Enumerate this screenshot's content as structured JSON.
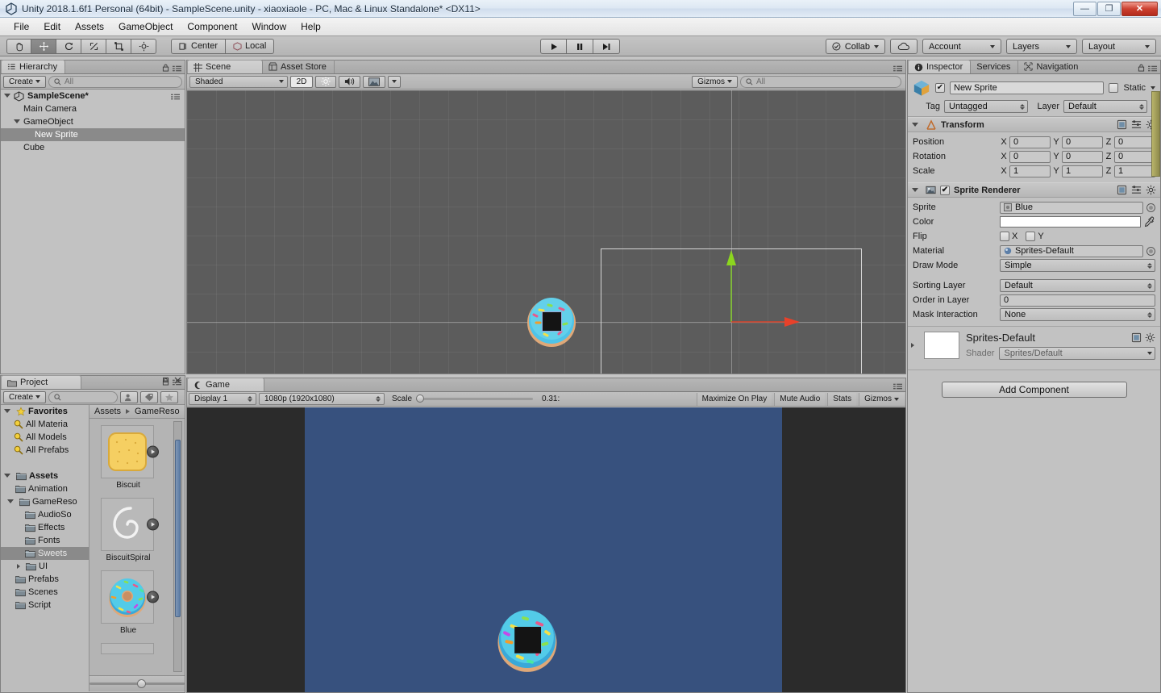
{
  "window": {
    "title": "Unity 2018.1.6f1 Personal (64bit) - SampleScene.unity - xiaoxiaole - PC, Mac & Linux Standalone* <DX11>",
    "minimize": "—",
    "maximize": "❐",
    "close": "✕"
  },
  "menu": {
    "items": [
      "File",
      "Edit",
      "Assets",
      "GameObject",
      "Component",
      "Window",
      "Help"
    ]
  },
  "toolbar": {
    "tools": [
      "hand-tool",
      "move-tool",
      "rotate-tool",
      "scale-tool",
      "rect-tool",
      "transform-tool"
    ],
    "active_tool_index": 1,
    "pivot": "Center",
    "handle": "Local",
    "play": "▶",
    "pause": "❚❚",
    "step": "▶❙",
    "collab": "Collab",
    "cloud": "cloud-icon",
    "account": "Account",
    "layers": "Layers",
    "layout": "Layout"
  },
  "hierarchy": {
    "tab": "Hierarchy",
    "create": "Create",
    "search_placeholder": "All",
    "rows": [
      {
        "label": "SampleScene*",
        "depth": 0,
        "type": "scene",
        "selected": false
      },
      {
        "label": "Main Camera",
        "depth": 1,
        "type": "object",
        "selected": false
      },
      {
        "label": "GameObject",
        "depth": 1,
        "type": "parent",
        "selected": false
      },
      {
        "label": "New Sprite",
        "depth": 2,
        "type": "object",
        "selected": true
      },
      {
        "label": "Cube",
        "depth": 1,
        "type": "object",
        "selected": false
      }
    ]
  },
  "scene": {
    "tabs": [
      "Scene",
      "Asset Store"
    ],
    "active_tab": "Scene",
    "shading": "Shaded",
    "mode_2d": "2D",
    "lighting": "lighting-icon",
    "audio": "audio-icon",
    "fx": "fx-icon",
    "gizmos": "Gizmos",
    "search_placeholder": "All"
  },
  "game": {
    "tab": "Game",
    "display": "Display 1",
    "resolution": "1080p (1920x1080)",
    "scale_label": "Scale",
    "scale_value": "0.31:",
    "maximize_on_play": "Maximize On Play",
    "mute_audio": "Mute Audio",
    "stats": "Stats",
    "gizmos": "Gizmos"
  },
  "project": {
    "tab": "Project",
    "create": "Create",
    "search_placeholder": "",
    "breadcrumb": [
      "Assets",
      "GameReso"
    ],
    "tree": [
      {
        "label": "Favorites",
        "depth": 0,
        "kind": "favorites",
        "bold": true,
        "expanded": true,
        "selected": false
      },
      {
        "label": "All Materia",
        "depth": 1,
        "kind": "search",
        "bold": false,
        "selected": false
      },
      {
        "label": "All Models",
        "depth": 1,
        "kind": "search",
        "bold": false,
        "selected": false
      },
      {
        "label": "All Prefabs",
        "depth": 1,
        "kind": "search",
        "bold": false,
        "selected": false
      },
      {
        "label": "",
        "depth": 0,
        "kind": "spacer",
        "bold": false,
        "selected": false
      },
      {
        "label": "Assets",
        "depth": 0,
        "kind": "folder",
        "bold": true,
        "expanded": true,
        "selected": false
      },
      {
        "label": "Animation",
        "depth": 1,
        "kind": "folder",
        "bold": false,
        "selected": false
      },
      {
        "label": "GameReso",
        "depth": 1,
        "kind": "folder",
        "bold": false,
        "expanded": true,
        "selected": false
      },
      {
        "label": "AudioSo",
        "depth": 2,
        "kind": "folder",
        "bold": false,
        "selected": false
      },
      {
        "label": "Effects",
        "depth": 2,
        "kind": "folder",
        "bold": false,
        "selected": false
      },
      {
        "label": "Fonts",
        "depth": 2,
        "kind": "folder",
        "bold": false,
        "selected": false
      },
      {
        "label": "Sweets",
        "depth": 2,
        "kind": "folder",
        "bold": false,
        "selected": true
      },
      {
        "label": "UI",
        "depth": 2,
        "kind": "folder",
        "bold": false,
        "collapsed": true,
        "selected": false
      },
      {
        "label": "Prefabs",
        "depth": 1,
        "kind": "folder",
        "bold": false,
        "selected": false
      },
      {
        "label": "Scenes",
        "depth": 1,
        "kind": "folder",
        "bold": false,
        "selected": false
      },
      {
        "label": "Script",
        "depth": 1,
        "kind": "folder",
        "bold": false,
        "selected": false
      }
    ],
    "assets": [
      {
        "label": "Biscuit",
        "thumb": "biscuit"
      },
      {
        "label": "BiscuitSpiral",
        "thumb": "spiral"
      },
      {
        "label": "Blue",
        "thumb": "donut"
      }
    ]
  },
  "inspector": {
    "tabs": [
      "Inspector",
      "Services",
      "Navigation"
    ],
    "active_tab": "Inspector",
    "object_name": "New Sprite",
    "enabled": true,
    "static_label": "Static",
    "static_checked": false,
    "tag_label": "Tag",
    "tag_value": "Untagged",
    "layer_label": "Layer",
    "layer_value": "Default",
    "transform": {
      "title": "Transform",
      "rows": [
        {
          "label": "Position",
          "x": "0",
          "y": "0",
          "z": "0"
        },
        {
          "label": "Rotation",
          "x": "0",
          "y": "0",
          "z": "0"
        },
        {
          "label": "Scale",
          "x": "1",
          "y": "1",
          "z": "1"
        }
      ],
      "axes": [
        "X",
        "Y",
        "Z"
      ]
    },
    "sprite_renderer": {
      "title": "Sprite Renderer",
      "enabled": true,
      "sprite_label": "Sprite",
      "sprite_value": "Blue",
      "color_label": "Color",
      "color_value": "#FFFFFF",
      "flip_label": "Flip",
      "flip_x": "X",
      "flip_y": "Y",
      "flip_x_checked": false,
      "flip_y_checked": false,
      "material_label": "Material",
      "material_value": "Sprites-Default",
      "draw_mode_label": "Draw Mode",
      "draw_mode_value": "Simple",
      "sorting_layer_label": "Sorting Layer",
      "sorting_layer_value": "Default",
      "order_in_layer_label": "Order in Layer",
      "order_in_layer_value": "0",
      "mask_interaction_label": "Mask Interaction",
      "mask_interaction_value": "None"
    },
    "material": {
      "name": "Sprites-Default",
      "shader_label": "Shader",
      "shader_value": "Sprites/Default"
    },
    "add_component": "Add Component"
  },
  "colors": {
    "panel_bg": "#c2c2c2",
    "scene_bg": "#5c5c5c",
    "game_bg": "#37517e",
    "game_letterbox": "#2b2b2b",
    "selection": "#8a8a8a",
    "gizmo_x": "#e8412a",
    "gizmo_y": "#8cd61f",
    "donut_frosting": "#4ec3e8",
    "donut_dough": "#dfa878"
  }
}
